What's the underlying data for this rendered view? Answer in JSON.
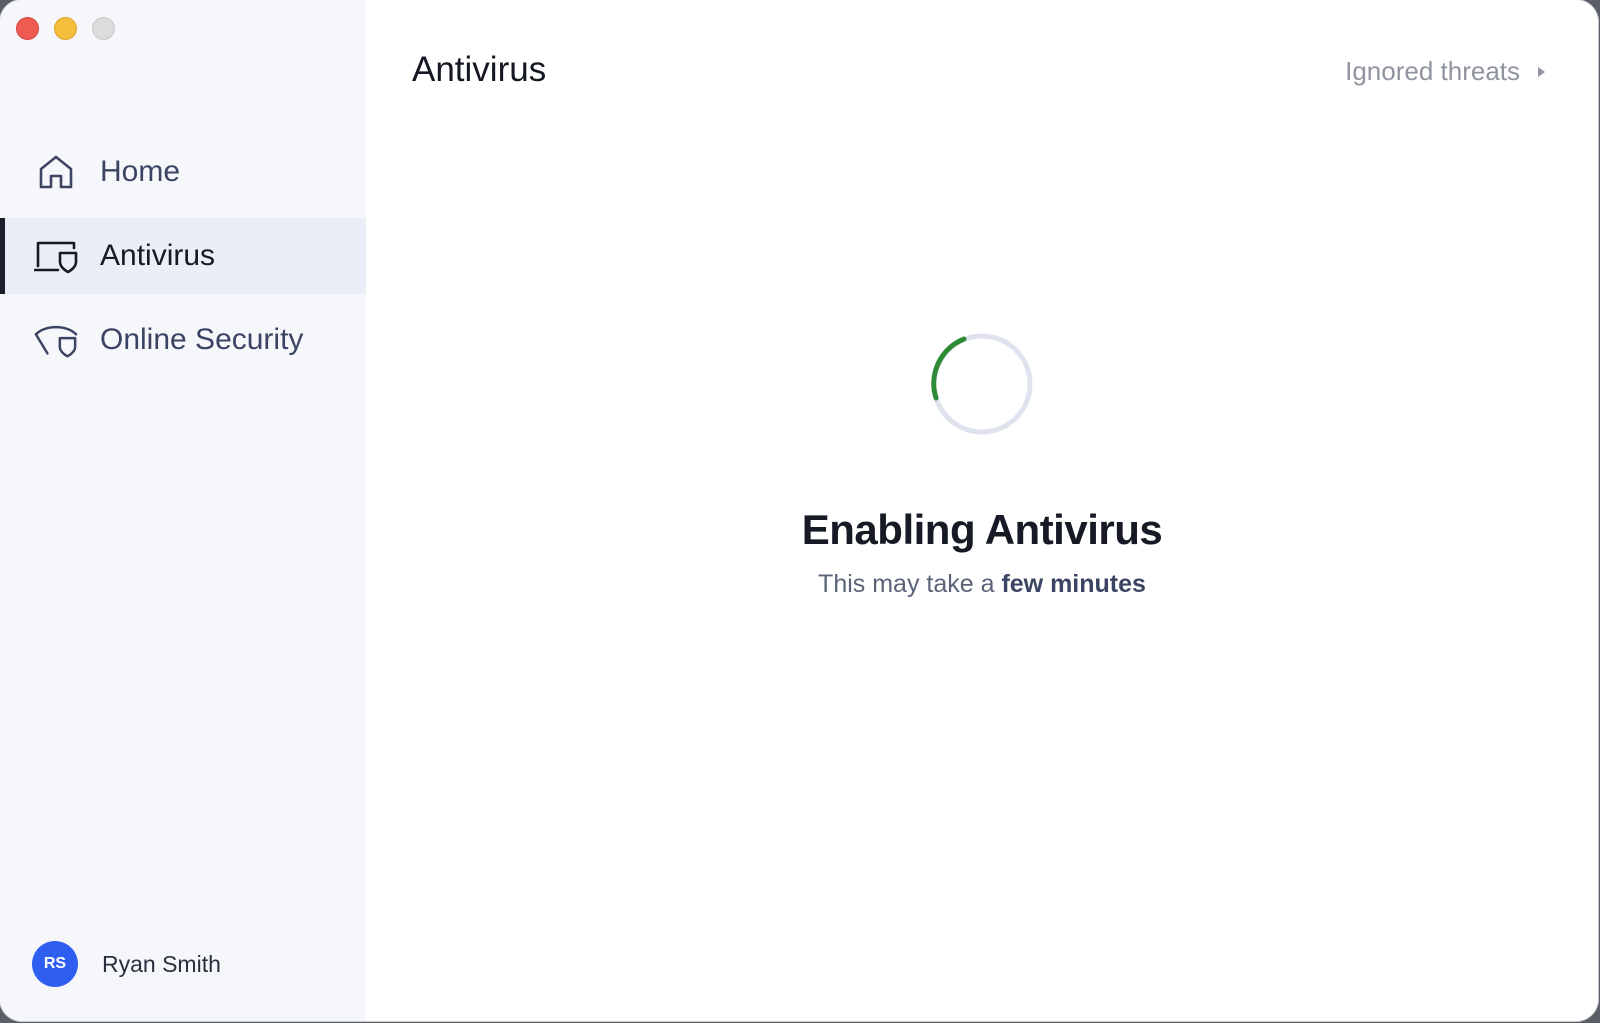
{
  "sidebar": {
    "items": [
      {
        "label": "Home",
        "icon": "home-icon",
        "active": false
      },
      {
        "label": "Antivirus",
        "icon": "device-shield-icon",
        "active": true
      },
      {
        "label": "Online Security",
        "icon": "web-shield-icon",
        "active": false
      }
    ],
    "user": {
      "initials": "RS",
      "name": "Ryan Smith"
    }
  },
  "main": {
    "title": "Antivirus",
    "ignored_threats_label": "Ignored threats",
    "status": {
      "heading": "Enabling Antivirus",
      "subtitle_prefix": "This may take a",
      "subtitle_emphasis": "few minutes"
    }
  },
  "colors": {
    "accent_green": "#2e8b35",
    "avatar_blue": "#2f5ff0",
    "sidebar_bg": "#f6f7fb",
    "active_item_bg": "#ebeef6"
  }
}
